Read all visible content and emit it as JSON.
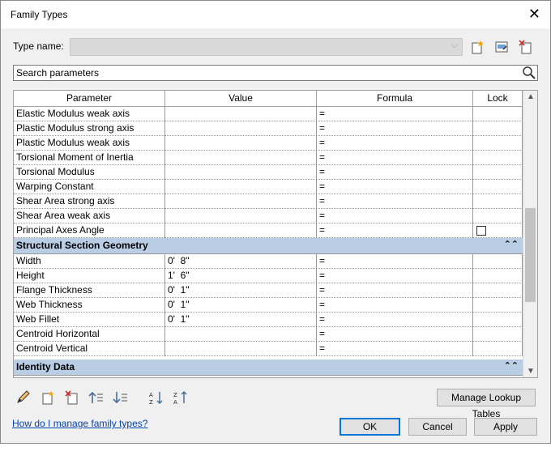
{
  "window": {
    "title": "Family Types"
  },
  "type_name": {
    "label": "Type name:",
    "value": ""
  },
  "search": {
    "placeholder": "Search parameters"
  },
  "columns": {
    "parameter": "Parameter",
    "value": "Value",
    "formula": "Formula",
    "lock": "Lock"
  },
  "rows_top": [
    {
      "parameter": "Elastic Modulus weak axis",
      "value": "",
      "formula": "=",
      "lock": false
    },
    {
      "parameter": "Plastic Modulus strong axis",
      "value": "",
      "formula": "=",
      "lock": false
    },
    {
      "parameter": "Plastic Modulus weak axis",
      "value": "",
      "formula": "=",
      "lock": false
    },
    {
      "parameter": "Torsional Moment of Inertia",
      "value": "",
      "formula": "=",
      "lock": false
    },
    {
      "parameter": "Torsional Modulus",
      "value": "",
      "formula": "=",
      "lock": false
    },
    {
      "parameter": "Warping Constant",
      "value": "",
      "formula": "=",
      "lock": false
    },
    {
      "parameter": "Shear Area strong axis",
      "value": "",
      "formula": "=",
      "lock": false
    },
    {
      "parameter": "Shear Area weak axis",
      "value": "",
      "formula": "=",
      "lock": false
    },
    {
      "parameter": "Principal Axes Angle",
      "value": "",
      "formula": "=",
      "lock": true
    }
  ],
  "group_geometry": {
    "label": "Structural Section Geometry",
    "collapse_glyph": "⌃⌃"
  },
  "rows_geometry": [
    {
      "parameter": "Width",
      "value": "0'  8\"",
      "formula": "="
    },
    {
      "parameter": "Height",
      "value": "1'  6\"",
      "formula": "="
    },
    {
      "parameter": "Flange Thickness",
      "value": "0'  1\"",
      "formula": "="
    },
    {
      "parameter": "Web Thickness",
      "value": "0'  1\"",
      "formula": "="
    },
    {
      "parameter": "Web Fillet",
      "value": "0'  1\"",
      "formula": "="
    },
    {
      "parameter": "Centroid Horizontal",
      "value": "",
      "formula": "="
    },
    {
      "parameter": "Centroid Vertical",
      "value": "",
      "formula": "="
    }
  ],
  "group_identity": {
    "label": "Identity Data",
    "collapse_glyph": "⌃⌃"
  },
  "buttons": {
    "manage_lookup": "Manage Lookup Tables",
    "ok": "OK",
    "cancel": "Cancel",
    "apply": "Apply"
  },
  "help_link": "How do I manage family types?",
  "icons": {
    "new_type": "new-type-icon",
    "rename_type": "rename-type-icon",
    "delete_type": "delete-type-icon",
    "search": "search-icon",
    "edit": "pencil-icon",
    "new_param": "new-parameter-icon",
    "delete_param": "delete-parameter-icon",
    "move_up": "move-up-icon",
    "move_down": "move-down-icon",
    "sort_asc": "sort-ascending-icon",
    "sort_desc": "sort-descending-icon"
  },
  "colors": {
    "group_header": "#b9cde5",
    "accent": "#0078d7"
  }
}
